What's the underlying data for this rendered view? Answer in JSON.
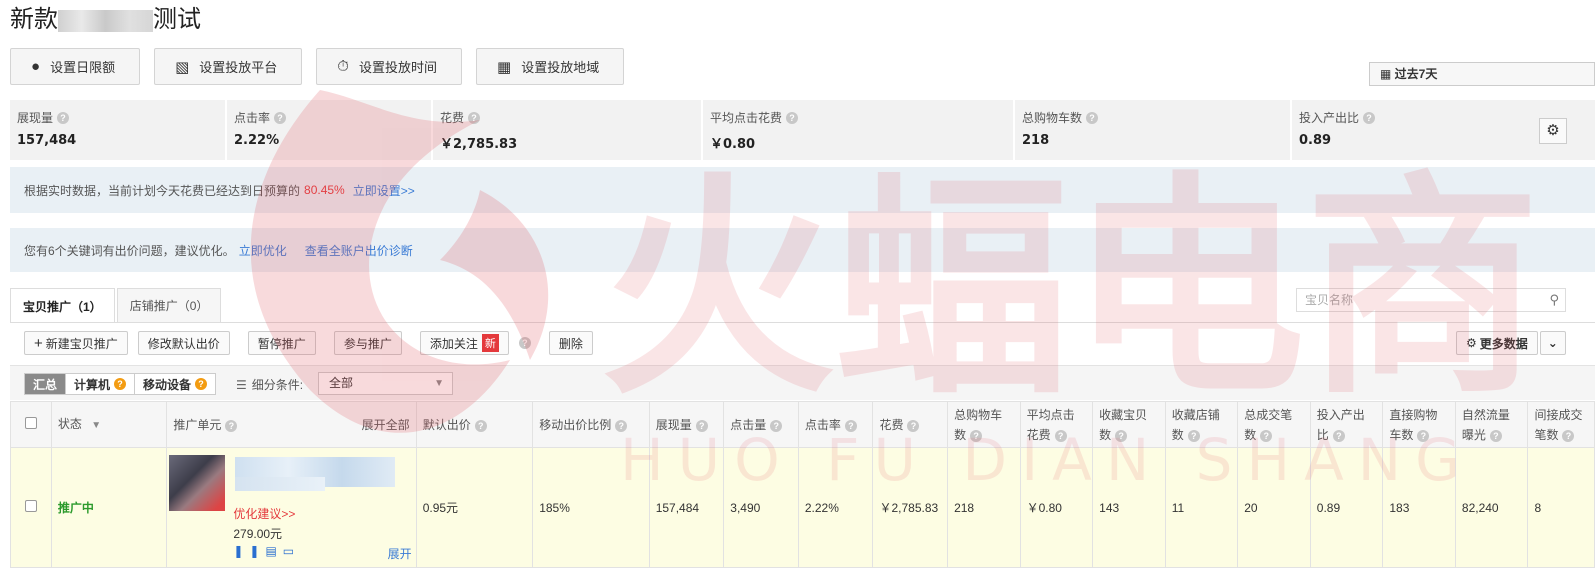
{
  "page": {
    "title_start": "新款",
    "title_end": "测试"
  },
  "settings": [
    {
      "icon": "money-bag-icon",
      "glyph": "💰",
      "label": "设置日限额"
    },
    {
      "icon": "laptop-icon",
      "glyph": "💻",
      "label": "设置投放平台"
    },
    {
      "icon": "clock-icon",
      "glyph": "⏱",
      "label": "设置投放时间"
    },
    {
      "icon": "map-icon",
      "glyph": "🗺",
      "label": "设置投放地域"
    }
  ],
  "date_range": "过去7天",
  "stats": [
    {
      "label": "展现量",
      "value": "157,484"
    },
    {
      "label": "点击率",
      "value": "2.22%"
    },
    {
      "label": "花费",
      "value": "￥2,785.83"
    },
    {
      "label": "平均点击花费",
      "value": "￥0.80"
    },
    {
      "label": "总购物车数",
      "value": "218"
    },
    {
      "label": "投入产出比",
      "value": "0.89"
    }
  ],
  "notice1": {
    "text": "根据实时数据，当前计划今天花费已经达到日预算的",
    "percent": "80.45%",
    "link": "立即设置>>"
  },
  "notice2": {
    "text": "您有6个关键词有出价问题，建议优化。",
    "link1": "立即优化",
    "link2": "查看全账户出价诊断"
  },
  "tabs": [
    {
      "label": "宝贝推广（1）"
    },
    {
      "label": "店铺推广（0）"
    }
  ],
  "search": {
    "placeholder": "宝贝名称"
  },
  "toolbar": {
    "new_label": "新建宝贝推广",
    "modify_label": "修改默认出价",
    "pause_label": "暂停推广",
    "join_label": "参与推广",
    "follow_label": "添加关注",
    "follow_badge": "新",
    "delete_label": "删除",
    "more_label": "更多数据"
  },
  "filter": {
    "segments": [
      "汇总",
      "计算机",
      "移动设备"
    ],
    "label": "细分条件:",
    "select_value": "全部"
  },
  "table": {
    "headers": {
      "status": "状态",
      "unit": "推广单元",
      "expand_all": "展开全部",
      "default_bid": "默认出价",
      "mobile_ratio": "移动出价比例",
      "impressions": "展现量",
      "clicks": "点击量",
      "ctr": "点击率",
      "cost": "花费",
      "cart": "总购物车数",
      "cpc": "平均点击花费",
      "fav_item": "收藏宝贝数",
      "fav_shop": "收藏店铺数",
      "orders": "总成交笔数",
      "roi": "投入产出比",
      "direct_cart": "直接购物车数",
      "natural_exposure": "自然流量曝光",
      "indirect_orders": "间接成交笔数"
    },
    "row": {
      "status": "推广中",
      "suggest": "优化建议>>",
      "price": "279.00元",
      "expand": "展开",
      "default_bid": "0.95元",
      "mobile_ratio": "185%",
      "impressions": "157,484",
      "clicks": "3,490",
      "ctr": "2.22%",
      "cost": "￥2,785.83",
      "cart": "218",
      "cpc": "￥0.80",
      "fav_item": "143",
      "fav_shop": "11",
      "orders": "20",
      "roi": "0.89",
      "direct_cart": "183",
      "natural_exposure": "82,240",
      "indirect_orders": "8"
    }
  },
  "watermark": {
    "cn": "火蝠电商",
    "en": "HUO FU DIAN SHANG",
    "color": "#e89aa0"
  }
}
